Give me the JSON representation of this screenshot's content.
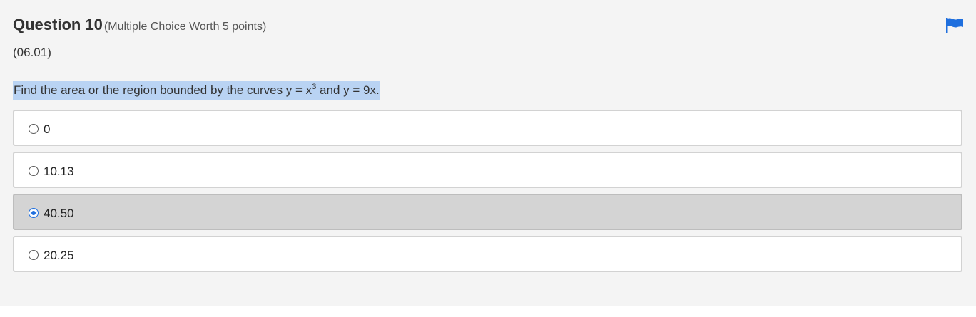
{
  "question": {
    "title": "Question 10",
    "worth": "(Multiple Choice Worth 5 points)",
    "standard": "(06.01)",
    "prompt_before": "Find the area or the region bounded by the curves y = x",
    "prompt_sup": "3",
    "prompt_after": " and y = 9x."
  },
  "options": [
    {
      "label": "0",
      "selected": false
    },
    {
      "label": "10.13",
      "selected": false
    },
    {
      "label": "40.50",
      "selected": true
    },
    {
      "label": "20.25",
      "selected": false
    }
  ],
  "colors": {
    "accent": "#1f6fde",
    "highlight": "#b9d3f3",
    "selected_bg": "#d4d4d4",
    "panel_bg": "#f4f4f4"
  },
  "icons": {
    "flag": "flag-icon"
  }
}
